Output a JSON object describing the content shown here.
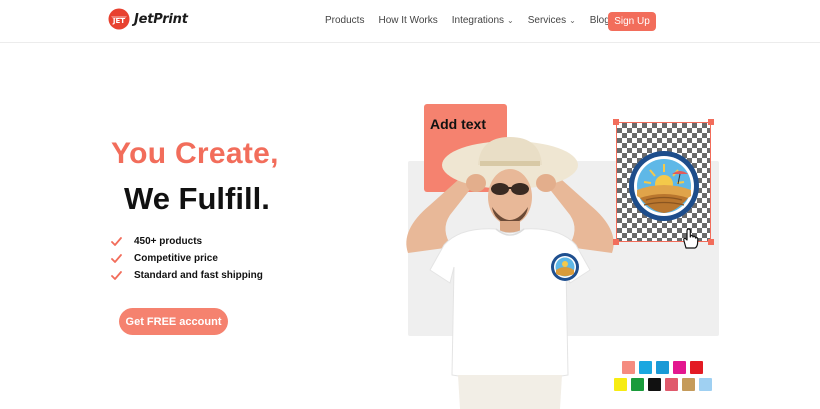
{
  "header": {
    "logo_text": "JetPrint",
    "logo_mark_text": "JET",
    "nav": [
      {
        "label": "Products",
        "dropdown": false
      },
      {
        "label": "How It Works",
        "dropdown": false
      },
      {
        "label": "Integrations",
        "dropdown": true
      },
      {
        "label": "Services",
        "dropdown": true
      },
      {
        "label": "Blog",
        "dropdown": false
      }
    ],
    "signup_label": "Sign Up"
  },
  "hero": {
    "title_line1": "You Create,",
    "title_line2": "We Fulfill.",
    "features": [
      "450+ products",
      "Competitive price",
      "Standard and fast shipping"
    ],
    "cta_label": "Get FREE account",
    "add_text_label": "Add text"
  },
  "colors": {
    "brand": "#f26d5b",
    "cta": "#f5826f",
    "swatches_row1": [
      "#f58c80",
      "#1ba7e0",
      "#1a9ad6",
      "#e3178f",
      "#e31b23"
    ],
    "swatches_row2": [
      "#f7ec12",
      "#1a9b3b",
      "#111111",
      "#e05a6c",
      "#c59b5b",
      "#9fd0f2"
    ]
  }
}
